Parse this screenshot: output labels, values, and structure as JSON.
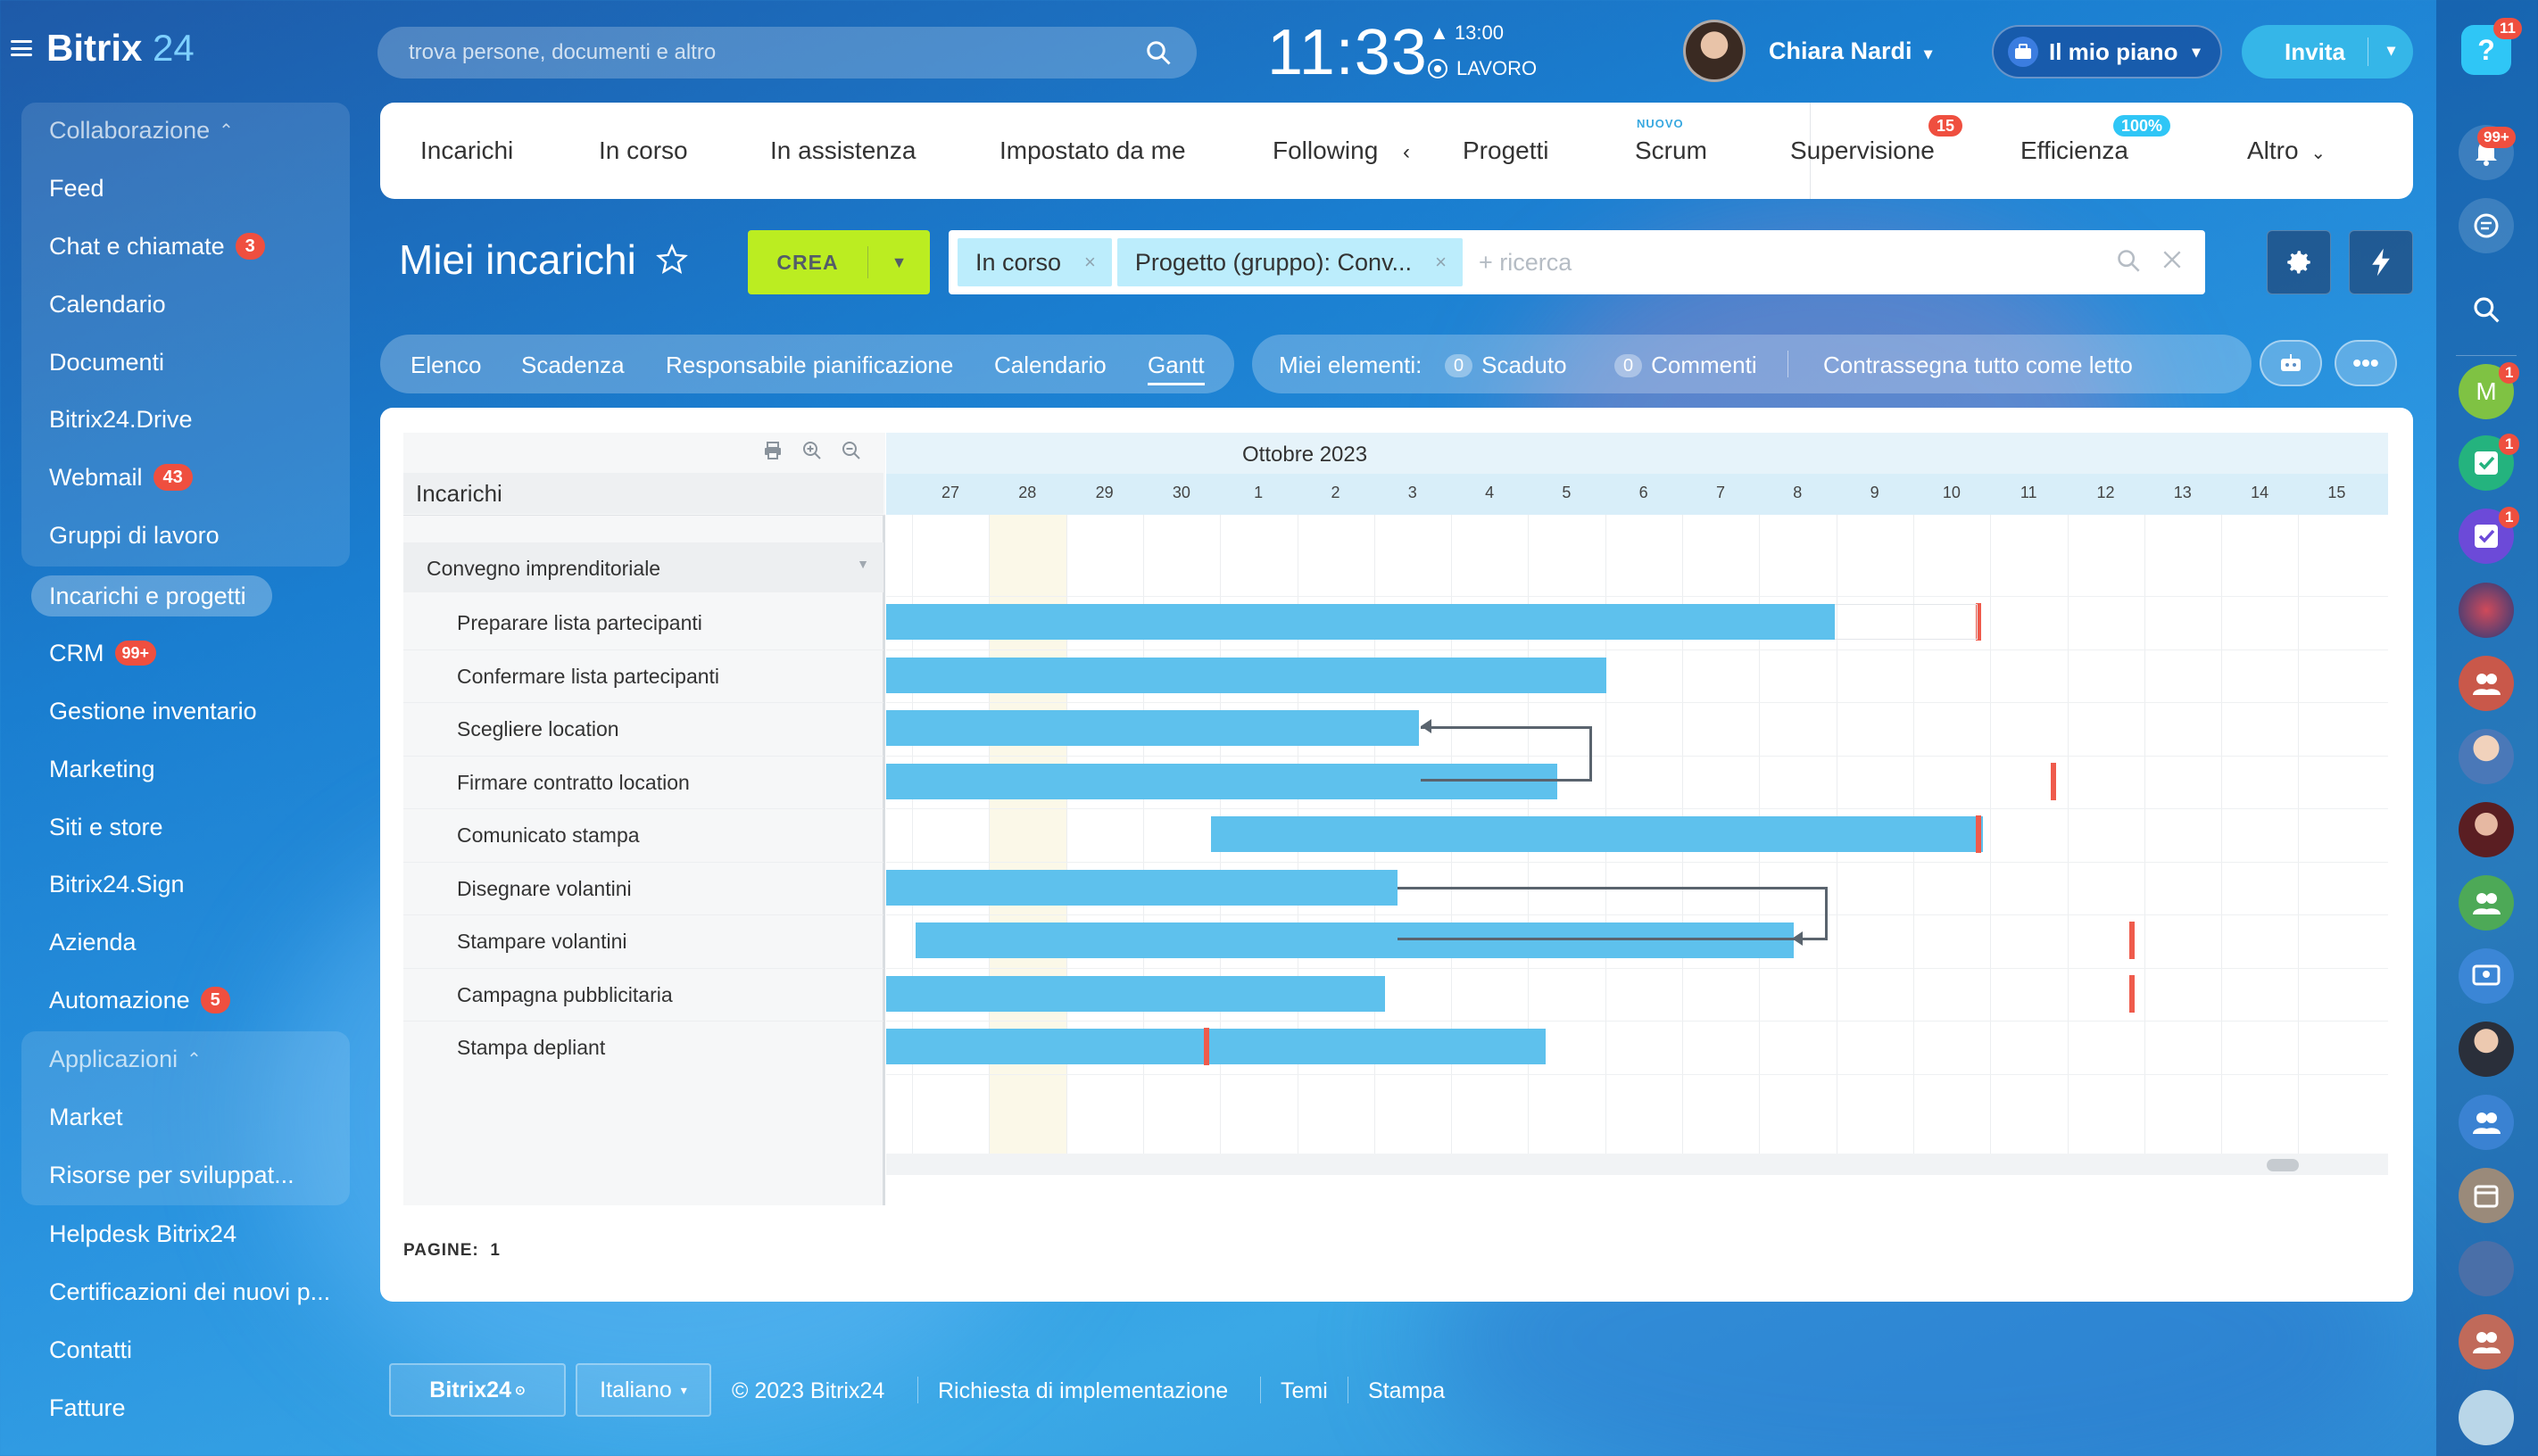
{
  "app": {
    "brand": "Bitrix",
    "brand_num": "24"
  },
  "sidebar": {
    "group1_header": "Collaborazione",
    "items1": [
      {
        "label": "Feed"
      },
      {
        "label": "Chat e chiamate",
        "badge": "3"
      },
      {
        "label": "Calendario"
      },
      {
        "label": "Documenti"
      },
      {
        "label": "Bitrix24.Drive"
      },
      {
        "label": "Webmail",
        "badge": "43"
      },
      {
        "label": "Gruppi di lavoro"
      }
    ],
    "items2": [
      {
        "label": "Incarichi e progetti"
      },
      {
        "label": "CRM",
        "badge": "99+"
      },
      {
        "label": "Gestione inventario"
      },
      {
        "label": "Marketing"
      },
      {
        "label": "Siti e store"
      },
      {
        "label": "Bitrix24.Sign"
      },
      {
        "label": "Azienda"
      },
      {
        "label": "Automazione",
        "badge": "5"
      }
    ],
    "group2_header": "Applicazioni",
    "items3": [
      {
        "label": "Market"
      },
      {
        "label": "Risorse per sviluppat..."
      }
    ],
    "items4": [
      {
        "label": "Helpdesk Bitrix24"
      },
      {
        "label": "Certificazioni dei nuovi p..."
      },
      {
        "label": "Contatti"
      },
      {
        "label": "Fatture"
      }
    ]
  },
  "header": {
    "search_placeholder": "trova persone, documenti e altro",
    "clock": "11:33",
    "alarm": "13:00",
    "work_status": "LAVORO",
    "user_name": "Chiara Nardi",
    "plan_label": "Il mio piano",
    "invite_label": "Invita"
  },
  "rail": {
    "help_badge": "11",
    "notif_badge": "99+",
    "m_badge": "1",
    "t1_badge": "1",
    "t2_badge": "1",
    "m_letter": "M"
  },
  "tabs": {
    "items": [
      "Incarichi",
      "In corso",
      "In assistenza",
      "Impostato da me",
      "Following",
      "Progetti",
      "Scrum",
      "Supervisione",
      "Efficienza",
      "Altro"
    ],
    "scrum_new": "NUOVO",
    "supervisione_badge": "15",
    "efficienza_badge": "100%"
  },
  "title": {
    "text": "Miei incarichi",
    "create_label": "CREA"
  },
  "filter": {
    "chips": [
      "In corso",
      "Progetto (gruppo): Conv..."
    ],
    "placeholder": "+ ricerca"
  },
  "views": {
    "items": [
      "Elenco",
      "Scadenza",
      "Responsabile pianificazione",
      "Calendario",
      "Gantt"
    ],
    "active": "Gantt"
  },
  "my_items": {
    "label": "Miei elementi:",
    "overdue_count": "0",
    "overdue_label": "Scaduto",
    "comments_count": "0",
    "comments_label": "Commenti",
    "mark_read": "Contrassegna tutto come letto"
  },
  "gantt": {
    "column_header": "Incarichi",
    "month": "Ottobre 2023",
    "days": [
      "27",
      "28",
      "29",
      "30",
      "1",
      "2",
      "3",
      "4",
      "5",
      "6",
      "7",
      "8",
      "9",
      "10",
      "11",
      "12",
      "13",
      "14",
      "15"
    ],
    "project": "Convegno imprenditoriale",
    "tasks": [
      "Preparare lista partecipanti",
      "Confermare lista partecipanti",
      "Scegliere location",
      "Firmare contratto location",
      "Comunicato stampa",
      "Disegnare volantini",
      "Stampare volantini",
      "Campagna pubblicitaria",
      "Stampa depliant"
    ],
    "pages_label": "PAGINE:",
    "pages_value": "1",
    "colors": {
      "bar": "#5ec1ed",
      "deadline": "#ef5b4c",
      "weekend": "#fbf8e8"
    }
  },
  "footer": {
    "brand": "Bitrix24",
    "language": "Italiano",
    "copyright": "© 2023 Bitrix24",
    "links": [
      "Richiesta di implementazione",
      "Temi",
      "Stampa"
    ]
  }
}
